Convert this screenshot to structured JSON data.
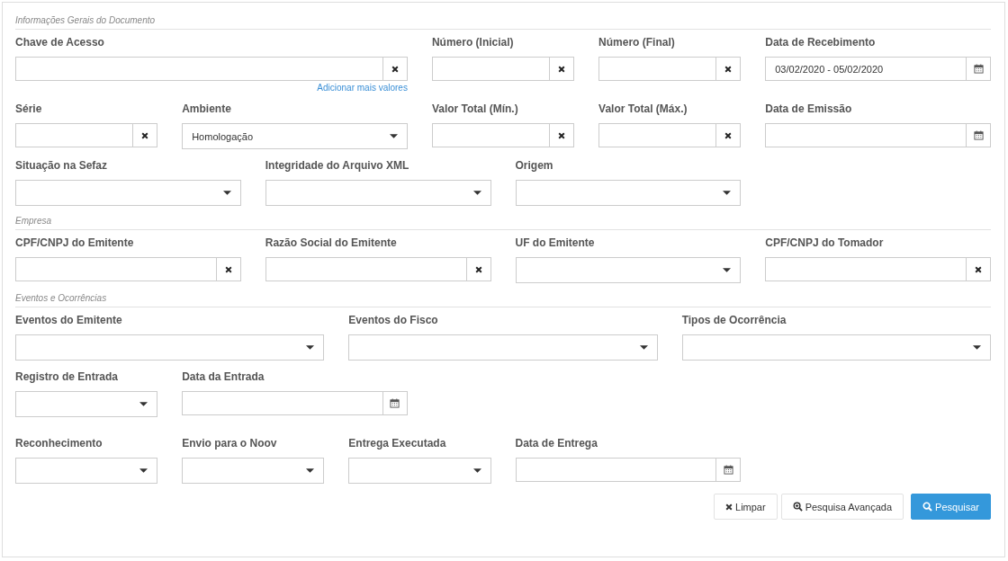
{
  "sections": [
    {
      "legend": "Informações Gerais do Documento",
      "rows": [
        {
          "fields": [
            {
              "label": "Chave de Acesso",
              "kind": "clear",
              "link": "Adicionar mais valores"
            },
            {
              "label": "Número (Inicial)",
              "kind": "clear"
            },
            {
              "label": "Número (Final)",
              "kind": "clear"
            },
            {
              "label": "Data de Recebimento",
              "kind": "date",
              "value": "03/02/2020 - 05/02/2020"
            }
          ]
        },
        {
          "fields": [
            {
              "label": "Série",
              "kind": "clear"
            },
            {
              "label": "Ambiente",
              "kind": "select",
              "value": "Homologação"
            },
            {
              "label": "Valor Total (Mín.)",
              "kind": "clear"
            },
            {
              "label": "Valor Total (Máx.)",
              "kind": "clear"
            },
            {
              "label": "Data de Emissão",
              "kind": "date"
            }
          ]
        },
        {
          "fields": [
            {
              "label": "Situação na Sefaz",
              "kind": "select"
            },
            {
              "label": "Integridade do Arquivo XML",
              "kind": "select"
            },
            {
              "label": "Origem",
              "kind": "select"
            }
          ]
        }
      ]
    },
    {
      "legend": "Empresa",
      "rows": [
        {
          "fields": [
            {
              "label": "CPF/CNPJ do Emitente",
              "kind": "clear"
            },
            {
              "label": "Razão Social do Emitente",
              "kind": "clear"
            },
            {
              "label": "UF do Emitente",
              "kind": "select"
            },
            {
              "label": "CPF/CNPJ do Tomador",
              "kind": "clear"
            }
          ]
        }
      ]
    },
    {
      "legend": "Eventos e Ocorrências",
      "rows": [
        {
          "fields": [
            {
              "label": "Eventos do Emitente",
              "kind": "select"
            },
            {
              "label": "Eventos do Fisco",
              "kind": "select"
            },
            {
              "label": "Tipos de Ocorrência",
              "kind": "select"
            }
          ]
        },
        {
          "fields": [
            {
              "label": "Registro de Entrada",
              "kind": "select"
            },
            {
              "label": "Data da Entrada",
              "kind": "date"
            }
          ]
        },
        {
          "fields": [
            {
              "label": "Reconhecimento",
              "kind": "select"
            },
            {
              "label": "Envio para o Noov",
              "kind": "select"
            },
            {
              "label": "Entrega Executada",
              "kind": "select"
            },
            {
              "label": "Data de Entrega",
              "kind": "date"
            }
          ]
        }
      ]
    }
  ],
  "buttons": [
    {
      "label": "Limpar",
      "kind": "clear"
    },
    {
      "label": "Pesquisa Avançada",
      "kind": "advanced"
    },
    {
      "label": "Pesquisar",
      "kind": "search"
    }
  ]
}
